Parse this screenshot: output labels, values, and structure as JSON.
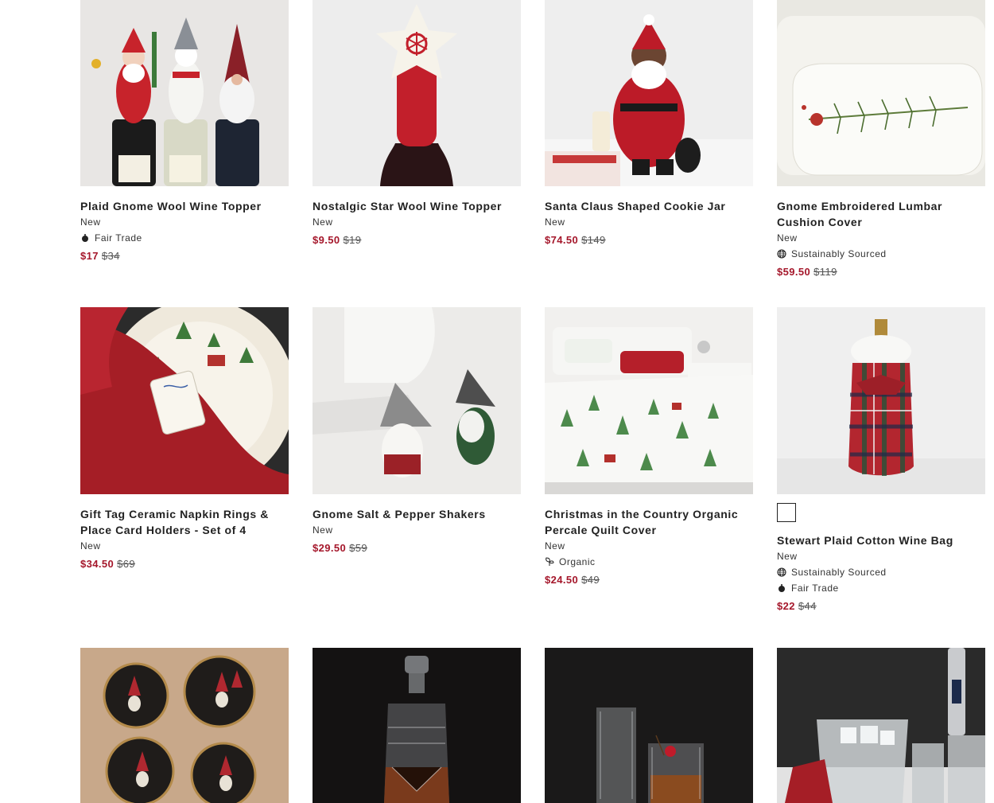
{
  "products": [
    {
      "title": "Plaid Gnome Wool Wine Topper",
      "badge": "New",
      "attributes": [
        {
          "label": "Fair Trade",
          "icon": "fair-trade-icon"
        }
      ],
      "sale_price": "$17",
      "original_price": "$34"
    },
    {
      "title": "Nostalgic Star Wool Wine Topper",
      "badge": "New",
      "attributes": [],
      "sale_price": "$9.50",
      "original_price": "$19"
    },
    {
      "title": "Santa Claus Shaped Cookie Jar",
      "badge": "New",
      "attributes": [],
      "sale_price": "$74.50",
      "original_price": "$149"
    },
    {
      "title": "Gnome Embroidered Lumbar Cushion Cover",
      "badge": "New",
      "attributes": [
        {
          "label": "Sustainably Sourced",
          "icon": "globe-icon"
        }
      ],
      "sale_price": "$59.50",
      "original_price": "$119"
    },
    {
      "title": "Gift Tag Ceramic Napkin Rings & Place Card Holders - Set of 4",
      "badge": "New",
      "attributes": [],
      "sale_price": "$34.50",
      "original_price": "$69"
    },
    {
      "title": "Gnome Salt & Pepper Shakers",
      "badge": "New",
      "attributes": [],
      "sale_price": "$29.50",
      "original_price": "$59"
    },
    {
      "title": "Christmas in the Country Organic Percale Quilt Cover",
      "badge": "New",
      "attributes": [
        {
          "label": "Organic",
          "icon": "leaf-icon"
        }
      ],
      "sale_price": "$24.50",
      "original_price": "$49"
    },
    {
      "title": "Stewart Plaid Cotton Wine Bag",
      "badge": "New",
      "attributes": [
        {
          "label": "Sustainably Sourced",
          "icon": "globe-icon"
        },
        {
          "label": "Fair Trade",
          "icon": "fair-trade-icon"
        }
      ],
      "sale_price": "$22",
      "original_price": "$44",
      "swatches": 1
    },
    {
      "title": "",
      "badge": "",
      "attributes": []
    },
    {
      "title": "",
      "badge": "",
      "attributes": []
    },
    {
      "title": "",
      "badge": "",
      "attributes": []
    },
    {
      "title": "",
      "badge": "",
      "attributes": []
    }
  ],
  "colors": {
    "sale": "#a5172b",
    "text": "#222222",
    "swatch_border": "#222222"
  }
}
